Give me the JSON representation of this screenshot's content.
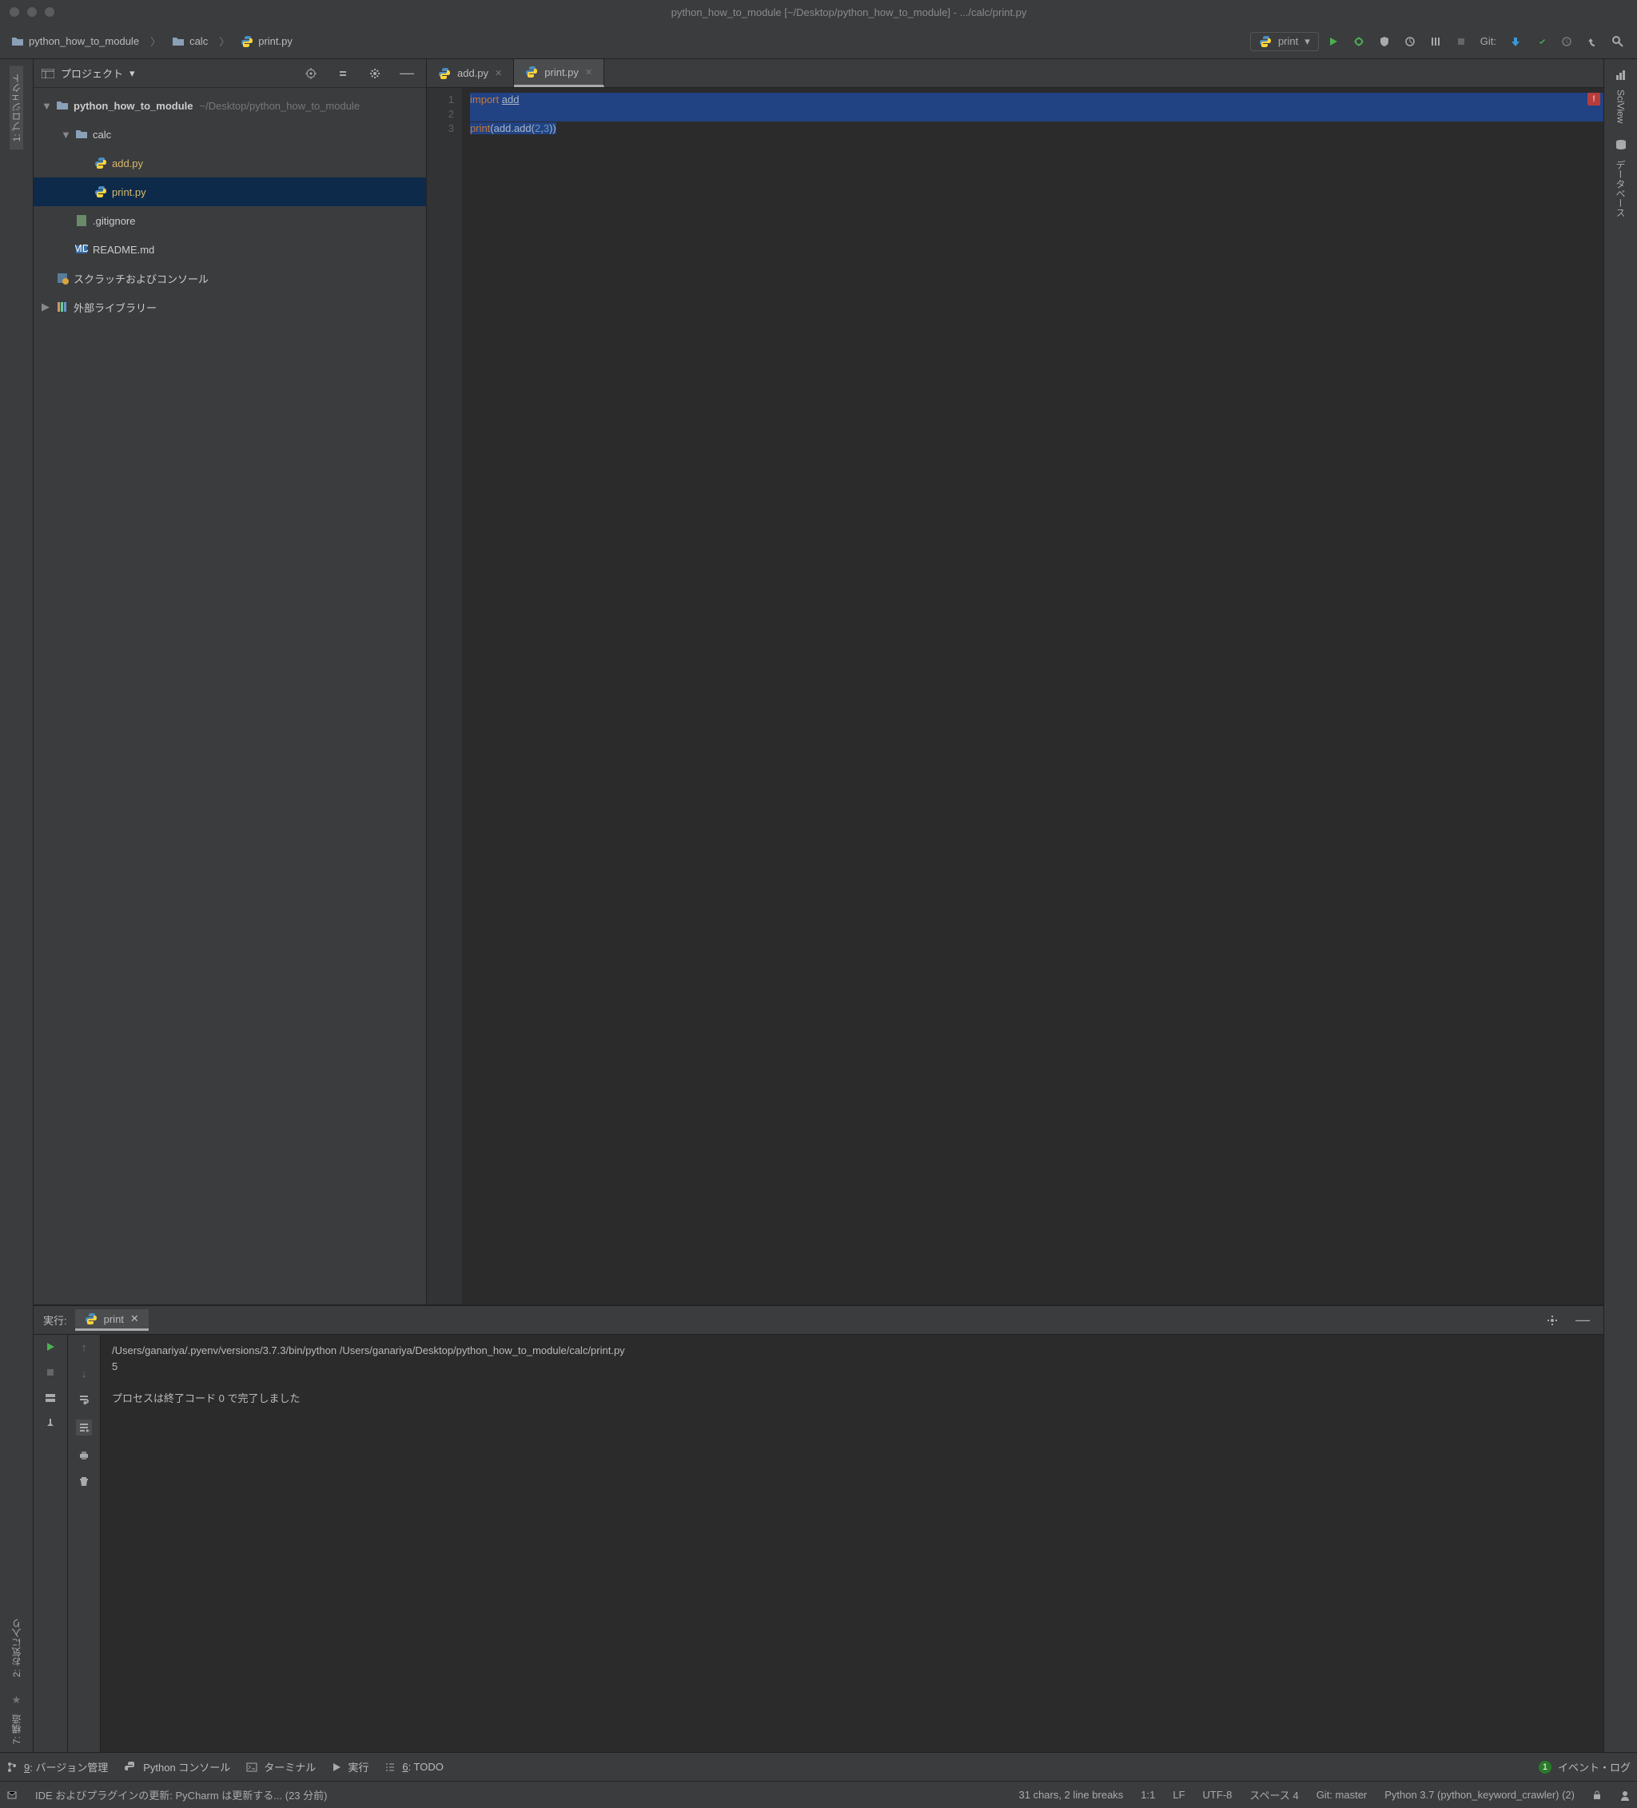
{
  "title": "python_how_to_module [~/Desktop/python_how_to_module] - .../calc/print.py",
  "breadcrumb": [
    {
      "icon": "folder",
      "label": "python_how_to_module"
    },
    {
      "icon": "folder",
      "label": "calc"
    },
    {
      "icon": "py",
      "label": "print.py"
    }
  ],
  "run_config_label": "print",
  "git_label": "Git:",
  "panel": {
    "title": "プロジェクト"
  },
  "tree": {
    "root": {
      "label": "python_how_to_module",
      "suffix": "~/Desktop/python_how_to_module"
    },
    "calc": "calc",
    "add": "add.py",
    "print": "print.py",
    "gitignore": ".gitignore",
    "readme": "README.md",
    "scratch": "スクラッチおよびコンソール",
    "ext": "外部ライブラリー"
  },
  "tabs": [
    {
      "label": "add.py"
    },
    {
      "label": "print.py"
    }
  ],
  "code": {
    "lines": [
      "1",
      "2",
      "3"
    ],
    "l1_kw": "import",
    "l1_mod": "add",
    "l3_fn": "print",
    "l3_open": "(",
    "l3_obj": "add.add",
    "l3_p1": "(",
    "l3_n1": "2",
    "l3_comma": ",",
    "l3_n2": "3",
    "l3_p2": ")",
    "l3_close": ")"
  },
  "error_marker": "!",
  "run": {
    "header": "実行:",
    "tab": "print",
    "line1": "/Users/ganariya/.pyenv/versions/3.7.3/bin/python /Users/ganariya/Desktop/python_how_to_module/calc/print.py",
    "line2": "5",
    "line3": "プロセスは終了コード 0 で完了しました"
  },
  "bottombar": {
    "vcs_num": "9",
    "vcs": ": バージョン管理",
    "pyconsole": "Python コンソール",
    "terminal": "ターミナル",
    "run": "実行",
    "todo_num": "6",
    "todo": ": TODO",
    "eventlog": "イベント・ログ",
    "eventcount": "1"
  },
  "status": {
    "msg": "IDE およびプラグインの更新: PyCharm は更新する... (23 分前)",
    "chars": "31 chars, 2 line breaks",
    "pos": "1:1",
    "lf": "LF",
    "enc": "UTF-8",
    "indent": "スペース 4",
    "git": "Git: master",
    "interp": "Python 3.7 (python_keyword_crawler) (2)"
  },
  "left_sidebar": {
    "project": "1: プロジェクト",
    "fav": "2: お気に入り",
    "structure": "7: 構造"
  },
  "right_sidebar": {
    "sciview": "SciView",
    "db": "データベース"
  }
}
